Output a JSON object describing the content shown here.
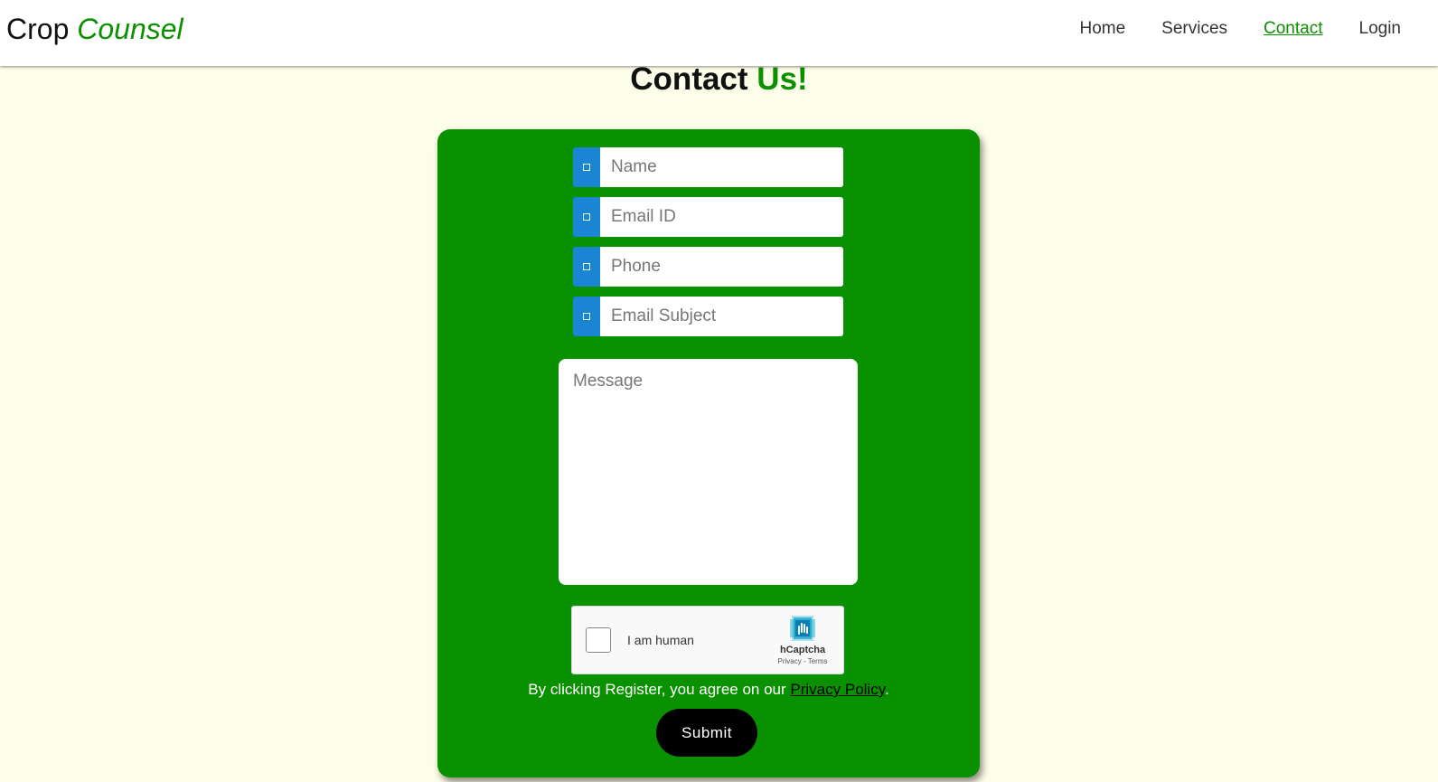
{
  "brand": {
    "first": "Crop",
    "accent": "Counsel"
  },
  "nav": {
    "home": "Home",
    "services": "Services",
    "contact": "Contact",
    "login": "Login"
  },
  "page_title": {
    "first": "Contact",
    "accent": "Us!"
  },
  "form": {
    "name_placeholder": "Name",
    "email_placeholder": "Email ID",
    "phone_placeholder": "Phone",
    "subject_placeholder": "Email Subject",
    "message_placeholder": "Message",
    "captcha_label": "I am human",
    "captcha_brand": "hCaptcha",
    "captcha_privacy": "Privacy",
    "captcha_separator": "-",
    "captcha_terms": "Terms",
    "terms_text": "By clicking Register, you agree on our ",
    "terms_link": "Privacy Policy",
    "terms_end": ".",
    "submit_label": "Submit"
  },
  "colors": {
    "accent": "#0a9100",
    "background": "#fdfee9",
    "icon_bg": "#1a85d2",
    "submit_bg": "#000000"
  },
  "icons": {
    "field_icon": "placeholder-square-icon",
    "captcha_logo": "hcaptcha-logo"
  }
}
